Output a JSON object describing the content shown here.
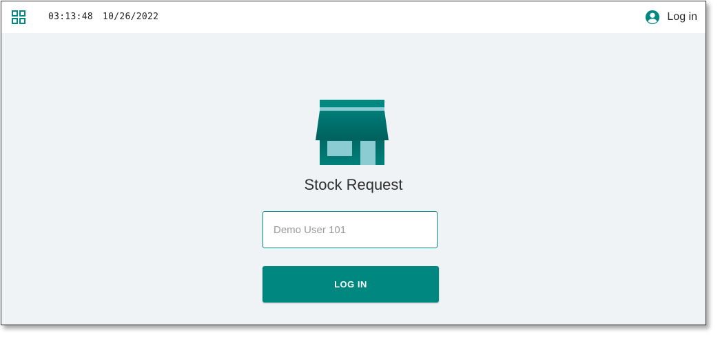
{
  "header": {
    "apps_icon": "grid-apps-icon",
    "time": "03:13:48",
    "date": "10/26/2022",
    "login_link_label": "Log in",
    "account_icon": "account-circle-icon"
  },
  "main": {
    "app_icon": "store-icon",
    "app_title": "Stock Request",
    "user_field": {
      "value": "",
      "placeholder": "Demo User 101"
    },
    "login_button_label": "LOG IN"
  },
  "colors": {
    "accent": "#00877f",
    "accent_dark": "#005e5a",
    "accent_light": "#8accd2",
    "background": "#eff3f6",
    "header_background": "#ffffff"
  }
}
